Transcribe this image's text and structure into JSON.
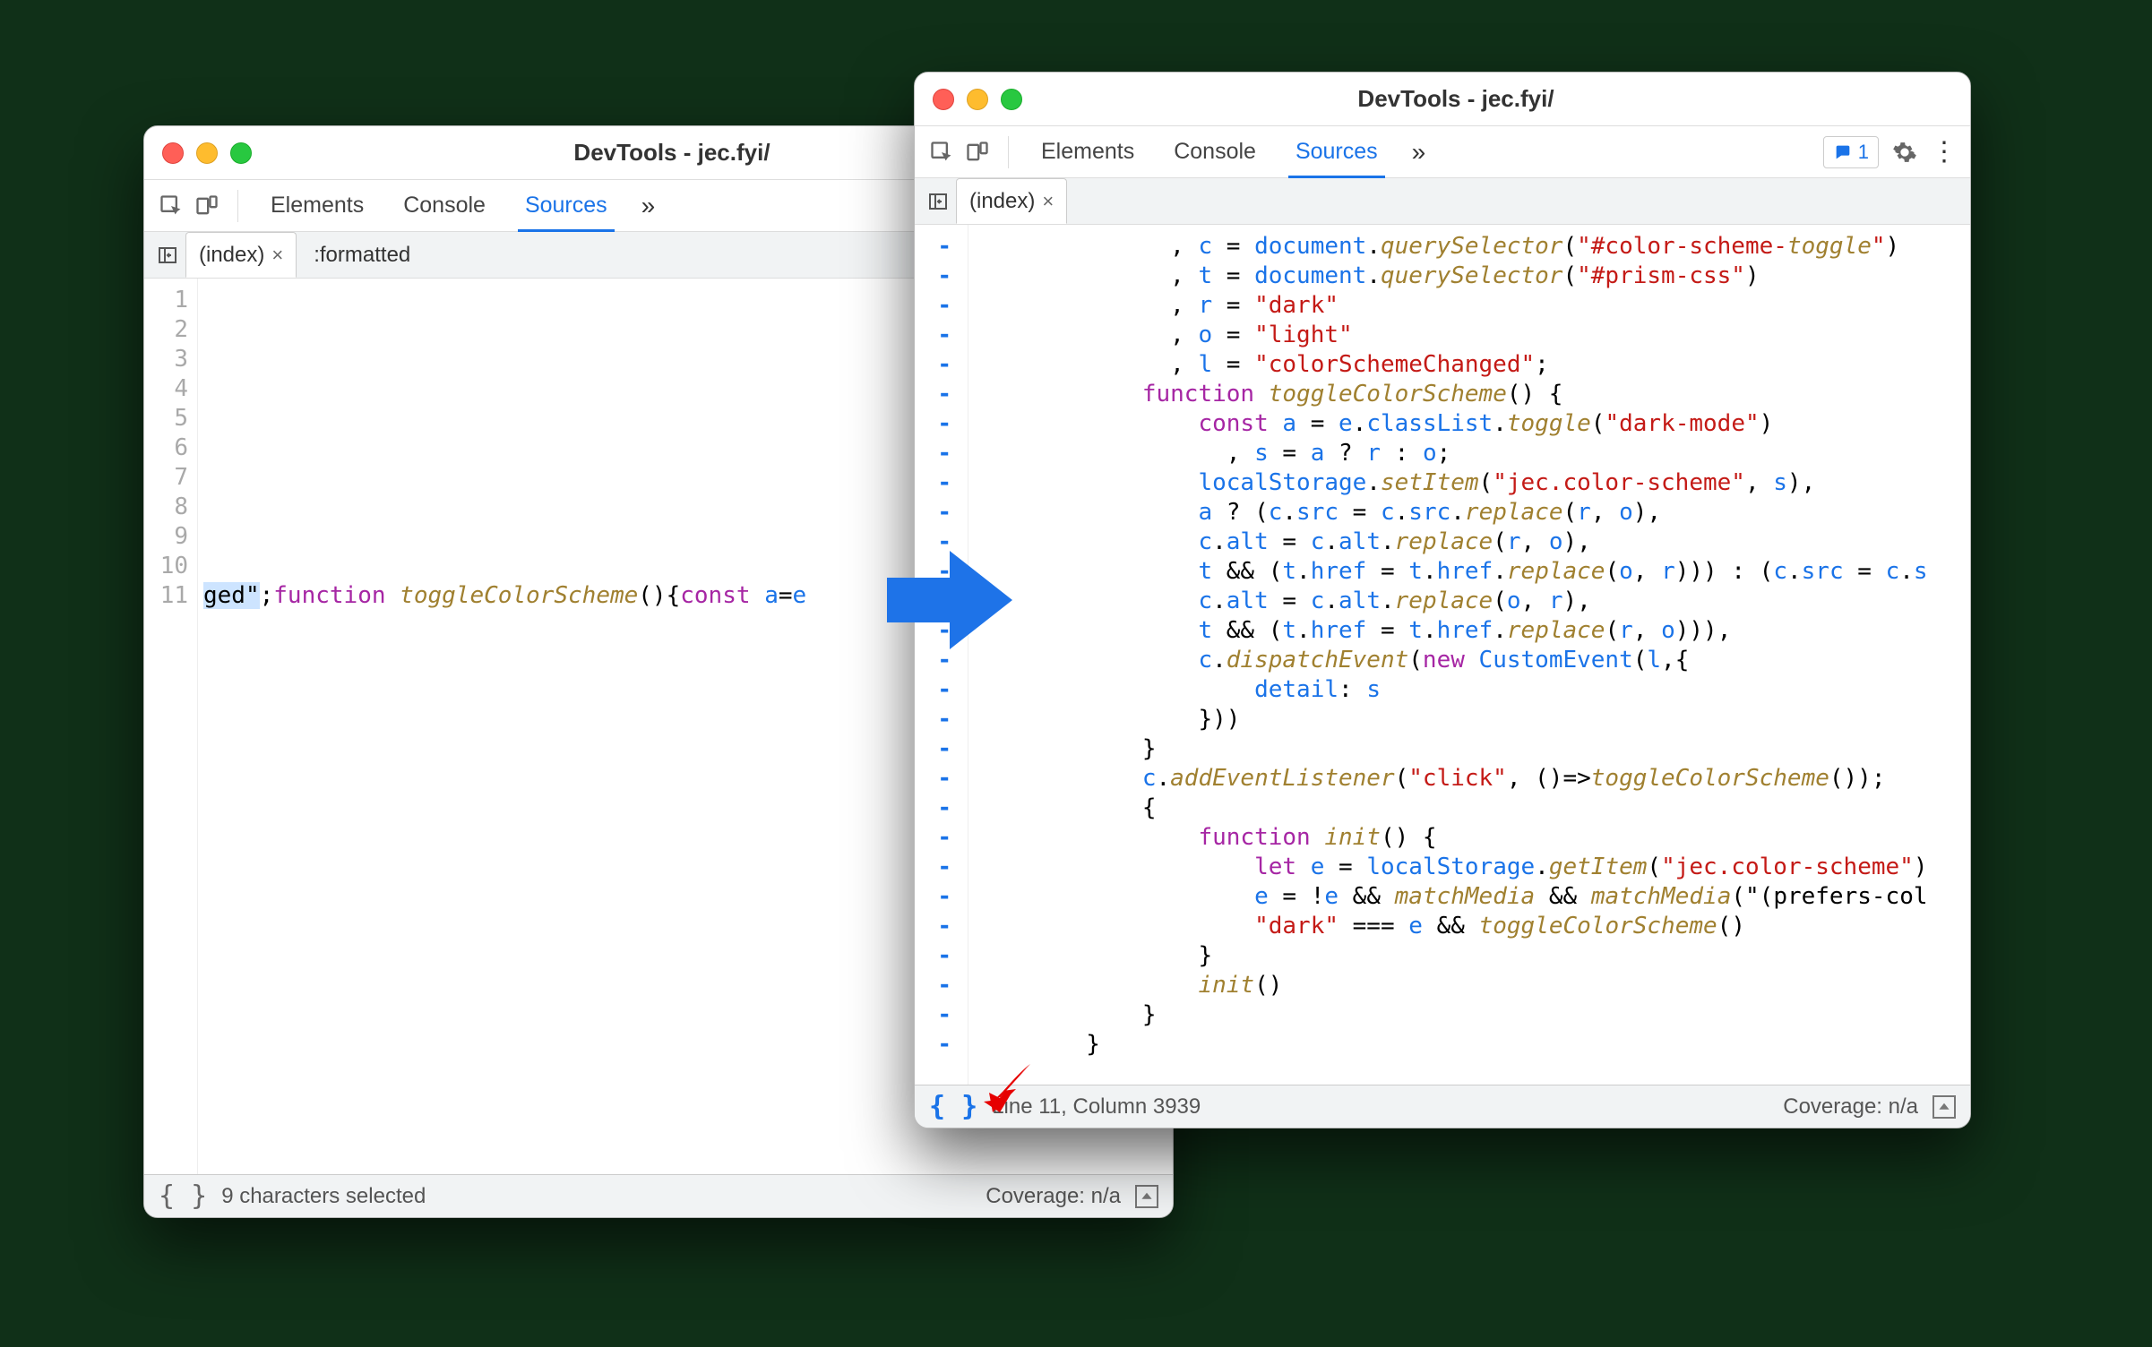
{
  "left": {
    "title": "DevTools - jec.fyi/",
    "tabs": [
      "Elements",
      "Console",
      "Sources"
    ],
    "active_tab": "Sources",
    "file_tabs": [
      {
        "label": "(index)",
        "active": true
      },
      {
        "label": ":formatted",
        "active": false
      }
    ],
    "line_numbers": [
      "1",
      "2",
      "3",
      "4",
      "5",
      "6",
      "7",
      "8",
      "9",
      "10",
      "11"
    ],
    "status_left": "9 characters selected",
    "status_right": "Coverage: n/a"
  },
  "right": {
    "title": "DevTools - jec.fyi/",
    "tabs": [
      "Elements",
      "Console",
      "Sources"
    ],
    "active_tab": "Sources",
    "issues_count": "1",
    "file_tabs": [
      {
        "label": "(index)",
        "active": true
      }
    ],
    "status_left": "Line 11, Column 3939",
    "status_right": "Coverage: n/a"
  },
  "code_left": {
    "frag_hl": "ged\"",
    "frag_rest": ";function toggleColorScheme(){const a=e",
    "raw": "ged\";function toggleColorScheme(){const a=e"
  },
  "code_right": {
    "lines": [
      "              , c = document.querySelector(\"#color-scheme-toggle\")",
      "              , t = document.querySelector(\"#prism-css\")",
      "              , r = \"dark\"",
      "              , o = \"light\"",
      "              , l = \"colorSchemeChanged\";",
      "            function toggleColorScheme() {",
      "                const a = e.classList.toggle(\"dark-mode\")",
      "                  , s = a ? r : o;",
      "                localStorage.setItem(\"jec.color-scheme\", s),",
      "                a ? (c.src = c.src.replace(r, o),",
      "                c.alt = c.alt.replace(r, o),",
      "                t && (t.href = t.href.replace(o, r))) : (c.src = c.s",
      "                c.alt = c.alt.replace(o, r),",
      "                t && (t.href = t.href.replace(r, o))),",
      "                c.dispatchEvent(new CustomEvent(l,{",
      "                    detail: s",
      "                }))",
      "            }",
      "            c.addEventListener(\"click\", ()=>toggleColorScheme());",
      "            {",
      "                function init() {",
      "                    let e = localStorage.getItem(\"jec.color-scheme\")",
      "                    e = !e && matchMedia && matchMedia(\"(prefers-col",
      "                    \"dark\" === e && toggleColorScheme()",
      "                }",
      "                init()",
      "            }",
      "        }"
    ]
  }
}
